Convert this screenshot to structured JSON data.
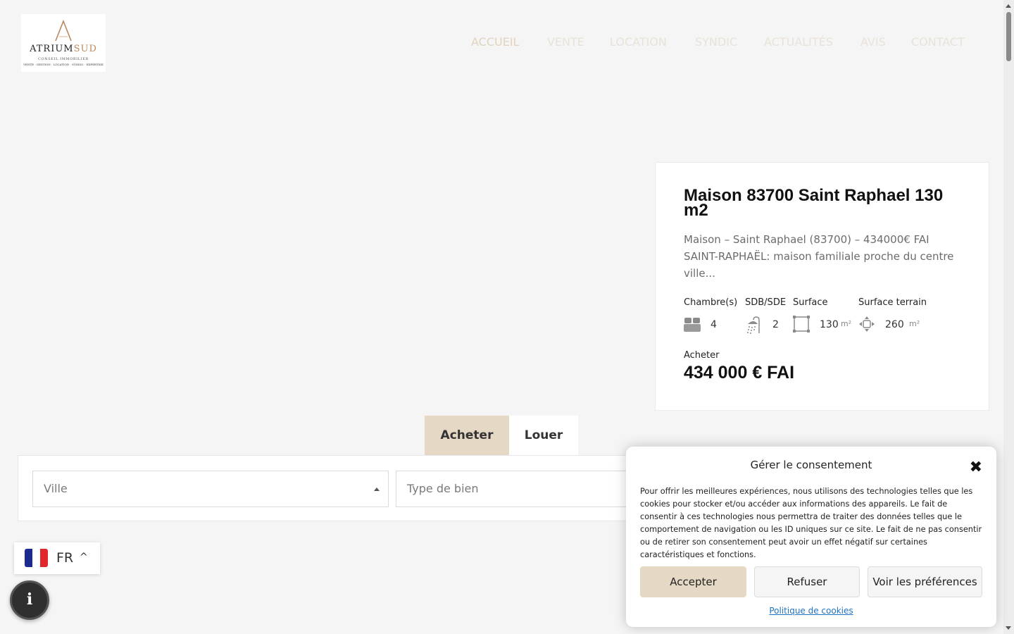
{
  "header": {
    "logo": {
      "brand_main": "ATRIUM",
      "brand_accent": "SUD",
      "tagline": "CONSEIL IMMOBILIER",
      "services": "VENTE · GESTION · LOCATION · SYNDIC · EXPERTISE"
    },
    "nav": [
      {
        "label": "ACCUEIL",
        "active": true
      },
      {
        "label": "VENTE",
        "active": false
      },
      {
        "label": "LOCATION",
        "active": false
      },
      {
        "label": "SYNDIC",
        "active": false
      },
      {
        "label": "ACTUALITÉS",
        "active": false
      },
      {
        "label": "AVIS",
        "active": false
      },
      {
        "label": "CONTACT",
        "active": false
      }
    ]
  },
  "property": {
    "title": "Maison 83700 Saint Raphael 130 m2",
    "description": "Maison – Saint Raphael (83700) – 434000€ FAI SAINT-RAPHAËL: maison familiale proche du centre ville...",
    "features": [
      {
        "label": "Chambre(s)",
        "value": "4",
        "unit": "",
        "icon": "bed-icon"
      },
      {
        "label": "SDB/SDE",
        "value": "2",
        "unit": "",
        "icon": "shower-icon"
      },
      {
        "label": "Surface",
        "value": "130",
        "unit": "m²",
        "icon": "area-icon"
      },
      {
        "label": "Surface terrain",
        "value": "260",
        "unit": "m²",
        "icon": "land-icon"
      }
    ],
    "transaction": "Acheter",
    "price": "434 000 € FAI"
  },
  "search": {
    "tabs": [
      "Acheter",
      "Louer"
    ],
    "ville_placeholder": "Ville",
    "type_placeholder": "Type de bien"
  },
  "language": {
    "code": "FR",
    "chevron": "^"
  },
  "info_button": {
    "icon": "i"
  },
  "consent": {
    "title": "Gérer le consentement",
    "close": "✖",
    "text": "Pour offrir les meilleures expériences, nous utilisons des technologies telles que les cookies pour stocker et/ou accéder aux informations des appareils. Le fait de consentir à ces technologies nous permettra de traiter des données telles que le comportement de navigation ou les ID uniques sur ce site. Le fait de ne pas consentir ou de retirer son consentement peut avoir un effet négatif sur certaines caractéristiques et fonctions.",
    "accept": "Accepter",
    "refuse": "Refuser",
    "preferences": "Voir les préférences",
    "policy_link": "Politique de cookies"
  },
  "colors": {
    "accent": "#e5d8c5",
    "logo_gold": "#b9895d",
    "link": "#1e73be"
  }
}
